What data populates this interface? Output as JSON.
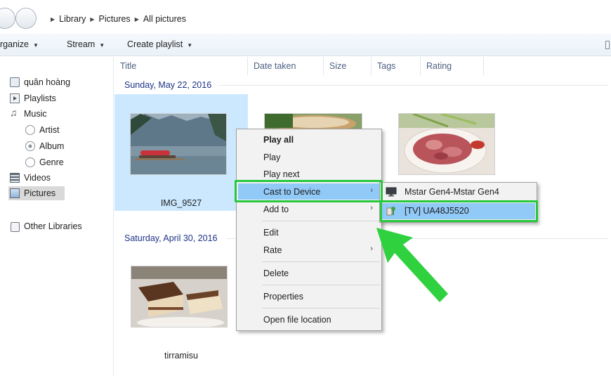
{
  "address_bar": {
    "breadcrumb": [
      "Library",
      "Pictures",
      "All pictures"
    ]
  },
  "toolbar": {
    "organize_label": "rganize",
    "stream_label": "Stream",
    "create_playlist_label": "Create playlist"
  },
  "nav_pane": {
    "user": "quân hoàng",
    "playlists": "Playlists",
    "music": "Music",
    "artist": "Artist",
    "album": "Album",
    "genre": "Genre",
    "videos": "Videos",
    "pictures": "Pictures",
    "other_libraries": "Other Libraries",
    "selected": "Pictures"
  },
  "columns": [
    "Title",
    "Date taken",
    "Size",
    "Tags",
    "Rating"
  ],
  "groups": [
    {
      "date": "Sunday, May 22, 2016",
      "items": [
        {
          "name": "IMG_9527",
          "icon": "lake-photo",
          "selected": true
        },
        {
          "name": "",
          "icon": "food-photo",
          "selected": false
        },
        {
          "name": "",
          "icon": "meat-photo",
          "selected": false
        }
      ]
    },
    {
      "date": "Saturday, April 30, 2016",
      "items": [
        {
          "name": "tirramisu",
          "icon": "cake-photo",
          "selected": false
        }
      ]
    }
  ],
  "context_menu": {
    "play_all": "Play all",
    "play": "Play",
    "play_next": "Play next",
    "cast_to_device": "Cast to Device",
    "add_to": "Add to",
    "edit": "Edit",
    "rate": "Rate",
    "delete": "Delete",
    "properties": "Properties",
    "open_file_location": "Open file location",
    "hovered": "Cast to Device"
  },
  "cast_submenu": {
    "device_1": "Mstar Gen4-Mstar Gen4",
    "device_2": "[TV] UA48J5520",
    "hovered": "[TV] UA48J5520"
  },
  "colors": {
    "highlight_green": "#28c83c",
    "menu_hover": "#91c9f7",
    "selection": "#cce8ff",
    "group_header": "#1e3287"
  }
}
